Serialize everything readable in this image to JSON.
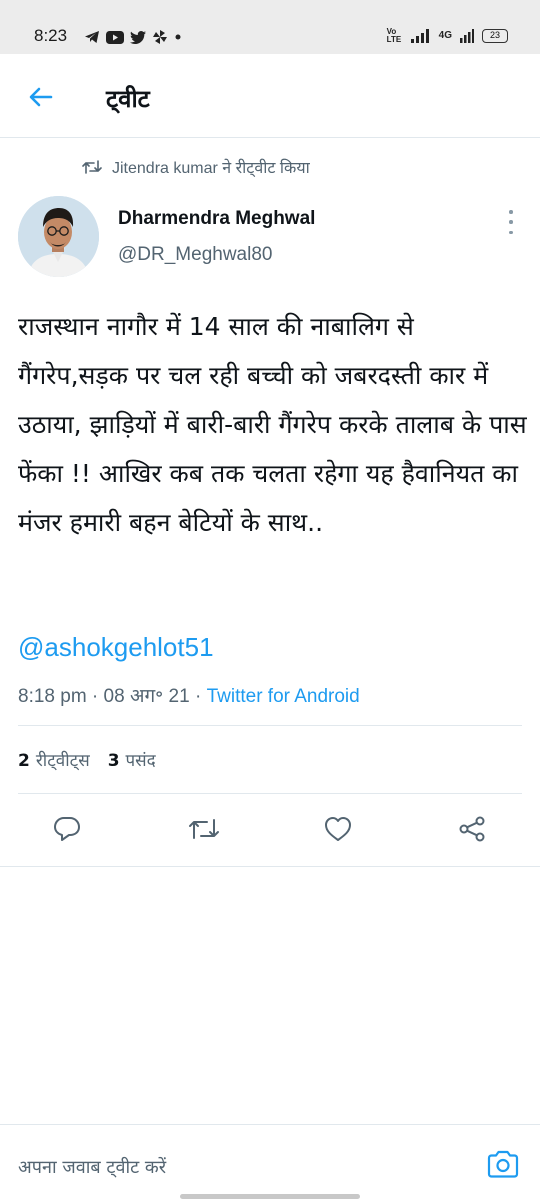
{
  "status_bar": {
    "time": "8:23",
    "network_label": "Vo LTE",
    "network_type": "4G",
    "battery_level": "23",
    "app_icons": [
      "telegram-icon",
      "youtube-icon",
      "twitter-icon",
      "pinwheel-icon"
    ]
  },
  "header": {
    "title": "ट्वीट"
  },
  "retweet": {
    "text": "Jitendra kumar ने रीट्वीट किया"
  },
  "author": {
    "name": "Dharmendra Meghwal",
    "handle": "@DR_Meghwal80"
  },
  "tweet": {
    "text": "राजस्थान नागौर  में 14 साल की नाबालिग से गैंगरेप,सड़क पर चल रही बच्ची को जबरदस्ती कार में उठाया, झाड़ियों में बारी-बारी गैंगरेप करके तालाब के पास फेंका !! आखिर कब तक चलता रहेगा यह हैवानियत का मंजर हमारी बहन बेटियों के साथ..",
    "mention": "@ashokgehlot51",
    "time": "8:18 pm",
    "separator": " · ",
    "date": "08 अग॰ 21",
    "source": "Twitter for Android"
  },
  "stats": {
    "retweets_count": "2",
    "retweets_label": "रीट्वीट्स",
    "likes_count": "3",
    "likes_label": "पसंद"
  },
  "reply": {
    "placeholder": "अपना जवाब ट्वीट करें"
  },
  "colors": {
    "accent": "#1d9bf0",
    "secondary_text": "#536471",
    "icon": "#536471",
    "divider": "#e1e8ed"
  }
}
